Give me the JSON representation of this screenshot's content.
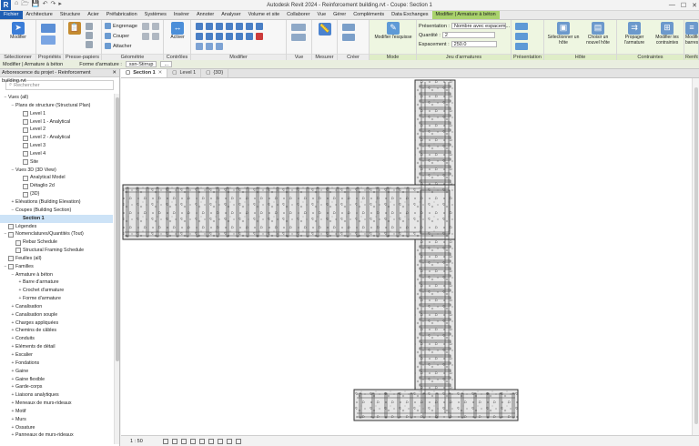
{
  "app": {
    "logo": "R",
    "title": "Autodesk Revit 2024 - Reinforcement building.rvt - Coupe: Section 1",
    "quick_access": [
      "⌂",
      "🗁",
      "💾",
      "↶",
      "↷",
      "▸"
    ],
    "window_controls": [
      "—",
      "☐",
      "✕"
    ]
  },
  "tabs": [
    "Fichier",
    "Architecture",
    "Structure",
    "Acier",
    "Préfabrication",
    "Systèmes",
    "Insérer",
    "Annoter",
    "Analyser",
    "Volume et site",
    "Collaborer",
    "Vue",
    "Gérer",
    "Compléments",
    "Data Exchanges",
    "Modifier | Armature à béton"
  ],
  "ribbon": {
    "panels": {
      "select": "Sélectionner",
      "properties": "Propriétés",
      "clipboard": "Presse-papiers",
      "geometry": "Géométrie",
      "controls": "Contrôles",
      "modify": "Modifier",
      "view": "Vue",
      "measure": "Mesurer",
      "create": "Créer",
      "mode": "Mode",
      "rebar_set": "Jeu d'armatures",
      "presentation": "Présentation",
      "host": "Hôte",
      "constraints": "Contraintes",
      "reinforcement": "Renfo"
    },
    "modify_label": "Modifier",
    "clipboard_items": [
      "Coller"
    ],
    "geometry_items": [
      "Engrenage",
      "Couper",
      "Attacher"
    ],
    "activate_label": "Activer",
    "equalize_label": "Modifier l'esquisse",
    "presentation_label": "Présentation :",
    "presentation_value": "Nombre avec espacem...",
    "quantity_label": "Quantité :",
    "quantity_value": "2",
    "spacing_label": "Espacement :",
    "spacing_value": "250.0",
    "host_buttons": [
      "Sélectionner un hôte",
      "Choisir un nouvel hôte"
    ],
    "constraint_buttons": [
      "Propager l'armature",
      "Modifier les contraintes"
    ],
    "renfo_buttons": [
      "Modifier les barres"
    ]
  },
  "options_bar": {
    "context": "Modifier | Armature à béton",
    "shape_label": "Forme d'armature :",
    "shape_value": "ssn-Stirrup",
    "more": "..."
  },
  "browser": {
    "title": "Arborescence du projet - Reinforcement building.rvt",
    "close": "✕",
    "search_placeholder": "Rechercher",
    "items": [
      {
        "level": 0,
        "toggle": "−",
        "icon": false,
        "label": "Vues (all)"
      },
      {
        "level": 1,
        "toggle": "−",
        "icon": false,
        "label": "Plans de structure (Structural Plan)"
      },
      {
        "level": 2,
        "toggle": "",
        "icon": true,
        "label": "Level 1"
      },
      {
        "level": 2,
        "toggle": "",
        "icon": true,
        "label": "Level 1 - Analytical"
      },
      {
        "level": 2,
        "toggle": "",
        "icon": true,
        "label": "Level 2"
      },
      {
        "level": 2,
        "toggle": "",
        "icon": true,
        "label": "Level 2 - Analytical"
      },
      {
        "level": 2,
        "toggle": "",
        "icon": true,
        "label": "Level 3"
      },
      {
        "level": 2,
        "toggle": "",
        "icon": true,
        "label": "Level 4"
      },
      {
        "level": 2,
        "toggle": "",
        "icon": true,
        "label": "Site"
      },
      {
        "level": 1,
        "toggle": "−",
        "icon": false,
        "label": "Vues 3D (3D View)"
      },
      {
        "level": 2,
        "toggle": "",
        "icon": true,
        "label": "Analytical Model"
      },
      {
        "level": 2,
        "toggle": "",
        "icon": true,
        "label": "Détaglio 2d"
      },
      {
        "level": 2,
        "toggle": "",
        "icon": true,
        "label": "{3D}"
      },
      {
        "level": 1,
        "toggle": "+",
        "icon": false,
        "label": "Elévations (Building Elevation)"
      },
      {
        "level": 1,
        "toggle": "−",
        "icon": false,
        "label": "Coupes (Building Section)"
      },
      {
        "level": 2,
        "toggle": "",
        "icon": false,
        "label": "Section 1",
        "selected": true
      },
      {
        "level": 0,
        "toggle": "",
        "icon": true,
        "label": "Légendes"
      },
      {
        "level": 0,
        "toggle": "−",
        "icon": true,
        "label": "Nomenclatures/Quantités (Tout)"
      },
      {
        "level": 1,
        "toggle": "",
        "icon": true,
        "label": "Rebar Schedule"
      },
      {
        "level": 1,
        "toggle": "",
        "icon": true,
        "label": "Structural Framing Schedule"
      },
      {
        "level": 0,
        "toggle": "",
        "icon": true,
        "label": "Feuilles (all)"
      },
      {
        "level": 0,
        "toggle": "−",
        "icon": true,
        "label": "Familles"
      },
      {
        "level": 1,
        "toggle": "−",
        "icon": false,
        "label": "Armature à béton"
      },
      {
        "level": 2,
        "toggle": "+",
        "icon": false,
        "label": "Barre d'armature"
      },
      {
        "level": 2,
        "toggle": "+",
        "icon": false,
        "label": "Crochet d'armature"
      },
      {
        "level": 2,
        "toggle": "+",
        "icon": false,
        "label": "Forme d'armature"
      },
      {
        "level": 1,
        "toggle": "+",
        "icon": false,
        "label": "Canalisation"
      },
      {
        "level": 1,
        "toggle": "+",
        "icon": false,
        "label": "Canalisation souple"
      },
      {
        "level": 1,
        "toggle": "+",
        "icon": false,
        "label": "Charges appliquées"
      },
      {
        "level": 1,
        "toggle": "+",
        "icon": false,
        "label": "Chemins de câbles"
      },
      {
        "level": 1,
        "toggle": "+",
        "icon": false,
        "label": "Conduits"
      },
      {
        "level": 1,
        "toggle": "+",
        "icon": false,
        "label": "Eléments de détail"
      },
      {
        "level": 1,
        "toggle": "+",
        "icon": false,
        "label": "Escalier"
      },
      {
        "level": 1,
        "toggle": "+",
        "icon": false,
        "label": "Fondations"
      },
      {
        "level": 1,
        "toggle": "+",
        "icon": false,
        "label": "Gaine"
      },
      {
        "level": 1,
        "toggle": "+",
        "icon": false,
        "label": "Gaine flexible"
      },
      {
        "level": 1,
        "toggle": "+",
        "icon": false,
        "label": "Garde-corps"
      },
      {
        "level": 1,
        "toggle": "+",
        "icon": false,
        "label": "Liaisons analytiques"
      },
      {
        "level": 1,
        "toggle": "+",
        "icon": false,
        "label": "Meneaux de murs-rideaux"
      },
      {
        "level": 1,
        "toggle": "+",
        "icon": false,
        "label": "Motif"
      },
      {
        "level": 1,
        "toggle": "+",
        "icon": false,
        "label": "Murs"
      },
      {
        "level": 1,
        "toggle": "+",
        "icon": false,
        "label": "Ossature"
      },
      {
        "level": 1,
        "toggle": "+",
        "icon": false,
        "label": "Panneaux de murs-rideaux"
      }
    ]
  },
  "view_tabs": [
    {
      "label": "Section 1",
      "active": true,
      "close": "✕"
    },
    {
      "label": "Level 1",
      "active": false,
      "close": ""
    },
    {
      "label": "{3D}",
      "active": false,
      "close": ""
    }
  ],
  "status": {
    "scale": "1 : 50"
  },
  "colors": {
    "file_tab": "#1f5fb4",
    "context_tab": "#a9d26c",
    "concrete_fill": "#e6e6e6",
    "outline": "#333333"
  }
}
